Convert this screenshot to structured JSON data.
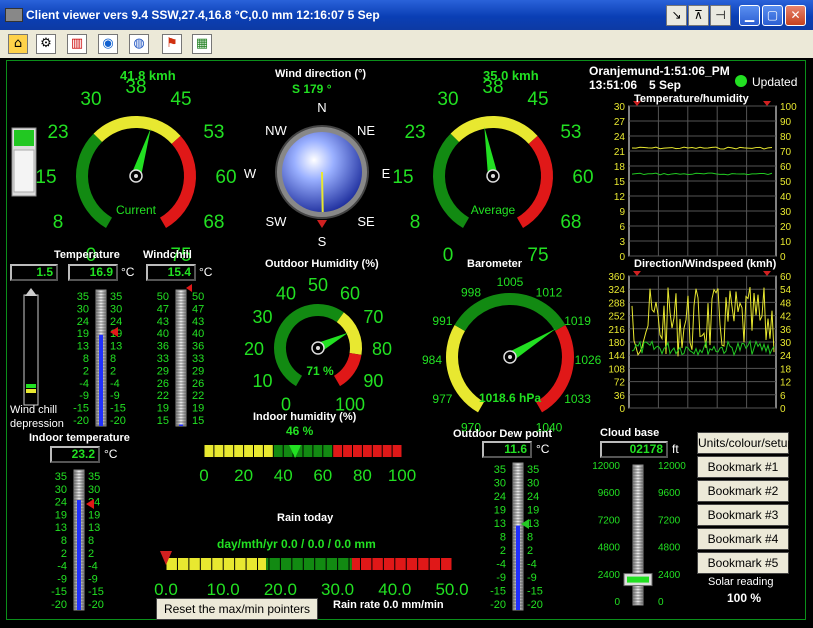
{
  "window": {
    "title": "Client viewer vers 9.4 SSW,27.4,16.8 °C,0.0 mm 12:16:07   5 Sep",
    "icons": [
      "back-icon",
      "pin-icon",
      "minimize-icon",
      "maximize-icon",
      "close-icon"
    ],
    "glyphs": {
      "g1": "↘",
      "g2": "⊼",
      "g3": "⊣",
      "min": "▁",
      "max": "▢",
      "close": "✕"
    }
  },
  "toolbar": {
    "tools": [
      "house-icon",
      "wrench-icon",
      "chart-icon",
      "globe-icon",
      "earth-icon",
      "flag-icon",
      "picture-icon"
    ],
    "glyphs": [
      "⌂",
      "⚙",
      "▥",
      "◉",
      "◍",
      "⚑",
      "▦"
    ]
  },
  "wind_current": {
    "speed": "41.8 kmh",
    "caption": "Current",
    "value_kmh": 41.8,
    "ticks": [
      "0",
      "8",
      "15",
      "23",
      "30",
      "38",
      "45",
      "53",
      "60",
      "68",
      "75"
    ]
  },
  "wind_average": {
    "speed": "35.0 kmh",
    "caption": "Average",
    "value_kmh": 35.0,
    "ticks": [
      "0",
      "8",
      "15",
      "23",
      "30",
      "38",
      "45",
      "53",
      "60",
      "68",
      "75"
    ]
  },
  "wind_direction": {
    "title": "Wind direction (°)",
    "value": "S 179 °",
    "degrees": 179,
    "compass": [
      "N",
      "NE",
      "E",
      "SE",
      "S",
      "SW",
      "W",
      "NW"
    ]
  },
  "station": {
    "name": "Oranjemund-1:51:06_PM",
    "time": "13:51:06",
    "date": "5 Sep",
    "status": "Updated"
  },
  "temp_humidity_chart": {
    "title": "Temperature/humidity",
    "left_ticks": [
      "30",
      "27",
      "24",
      "21",
      "18",
      "15",
      "12",
      "9",
      "6",
      "3",
      "0"
    ],
    "right_ticks": [
      "100",
      "90",
      "80",
      "70",
      "60",
      "50",
      "40",
      "30",
      "20",
      "10",
      "0"
    ]
  },
  "dir_speed_chart": {
    "title": "Direction/Windspeed (kmh)",
    "left_ticks": [
      "360",
      "324",
      "288",
      "252",
      "216",
      "180",
      "144",
      "108",
      "72",
      "36",
      "0"
    ],
    "right_ticks": [
      "60",
      "54",
      "48",
      "42",
      "36",
      "30",
      "24",
      "18",
      "12",
      "6",
      "0"
    ]
  },
  "temperature": {
    "title": "Temperature",
    "value": "16.9",
    "unit": "°C",
    "ticks": [
      "35",
      "30",
      "24",
      "19",
      "13",
      "8",
      "2",
      "-4",
      "-9",
      "-15",
      "-20"
    ],
    "level": 16.9
  },
  "windchill": {
    "title": "Windchill",
    "value": "15.4",
    "unit": "°C",
    "ticks": [
      "50",
      "47",
      "43",
      "40",
      "36",
      "33",
      "29",
      "26",
      "22",
      "19",
      "15"
    ],
    "level": 15.4
  },
  "windchill_depression": {
    "value": "1.5",
    "label1": "Wind chill",
    "label2": "depression"
  },
  "outdoor_humidity": {
    "title": "Outdoor Humidity (%)",
    "value": "71 %",
    "percent": 71,
    "ticks": [
      "0",
      "10",
      "20",
      "30",
      "40",
      "50",
      "60",
      "70",
      "80",
      "90",
      "100"
    ]
  },
  "barometer": {
    "title": "Barometer",
    "value": "1018.6 hPa",
    "hpa": 1018.6,
    "ticks": [
      "970",
      "977",
      "984",
      "991",
      "998",
      "1005",
      "1012",
      "1019",
      "1026",
      "1033",
      "1040"
    ]
  },
  "indoor_temperature": {
    "title": "Indoor temperature",
    "value": "23.2",
    "unit": "°C",
    "ticks": [
      "35",
      "30",
      "24",
      "19",
      "13",
      "8",
      "2",
      "-4",
      "-9",
      "-15",
      "-20"
    ],
    "level": 23.2
  },
  "indoor_humidity": {
    "title": "Indoor humidity (%)",
    "value": "46 %",
    "percent": 46,
    "ticks": [
      "0",
      "20",
      "40",
      "60",
      "80",
      "100"
    ]
  },
  "rain": {
    "title": "Rain today",
    "summary": "day/mth/yr 0.0 / 0.0 / 0.0 mm",
    "rate": "Rain rate 0.0 mm/min",
    "ticks": [
      "0.0",
      "10.0",
      "20.0",
      "30.0",
      "40.0",
      "50.0"
    ]
  },
  "dew_point": {
    "title": "Outdoor Dew point",
    "value": "11.6",
    "unit": "°C",
    "ticks": [
      "35",
      "30",
      "24",
      "19",
      "13",
      "8",
      "2",
      "-4",
      "-9",
      "-15",
      "-20"
    ],
    "level": 11.6
  },
  "cloud_base": {
    "title": "Cloud base",
    "value": "02178",
    "unit": "ft",
    "ticks": [
      "12000",
      "9600",
      "7200",
      "4800",
      "2400",
      "0"
    ],
    "level": 2178
  },
  "buttons": {
    "setup": "Units/colour/setup",
    "bookmarks": [
      "Bookmark #1",
      "Bookmark #2",
      "Bookmark #3",
      "Bookmark #4",
      "Bookmark #5"
    ],
    "reset": "Reset the max/min pointers"
  },
  "solar": {
    "label": "Solar reading",
    "value": "100 %"
  }
}
